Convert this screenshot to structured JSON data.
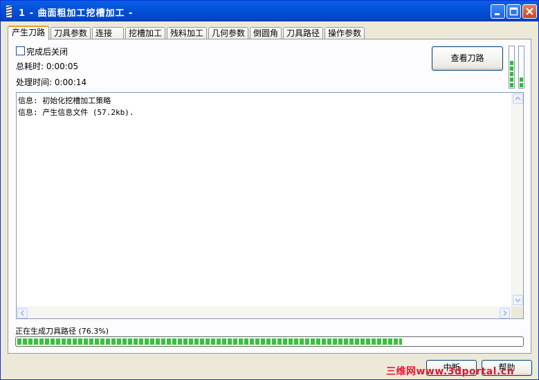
{
  "window": {
    "title": "1 - 曲面粗加工挖槽加工 -"
  },
  "icons": {
    "app": "app-icon",
    "minimize": "minimize-icon",
    "maximize": "maximize-icon",
    "close": "close-icon"
  },
  "tabs": [
    {
      "label": "产生刀路",
      "active": true
    },
    {
      "label": "刀具参数"
    },
    {
      "label": "连接"
    },
    {
      "label": "挖槽加工"
    },
    {
      "label": "残料加工"
    },
    {
      "label": "几何参数"
    },
    {
      "label": "倒圆角"
    },
    {
      "label": "刀具路径"
    },
    {
      "label": "操作参数"
    }
  ],
  "panel": {
    "close_on_finish": {
      "label": "完成后关闭",
      "checked": false
    },
    "total_time": "总耗时: 0:00:05",
    "process_time": "处理时间: 0:00:14",
    "view_toolpath_button": "查看刀路",
    "meter_levels": [
      0.65,
      0.25
    ]
  },
  "log": {
    "lines": [
      "信息: 初始化挖槽加工策略",
      "信息: 产生信息文件 (57.2kb)."
    ]
  },
  "status": {
    "text": "正在生成刀具路径 (76.3%)",
    "progress_percent": 76.3
  },
  "buttons": {
    "interrupt": "中断",
    "help": "帮助"
  },
  "watermark": "三维网www.3dportal.cn",
  "colors": {
    "titlebar": "#0352d8",
    "progress_green": "#36c336",
    "active_tab_accent": "#e6a032"
  }
}
